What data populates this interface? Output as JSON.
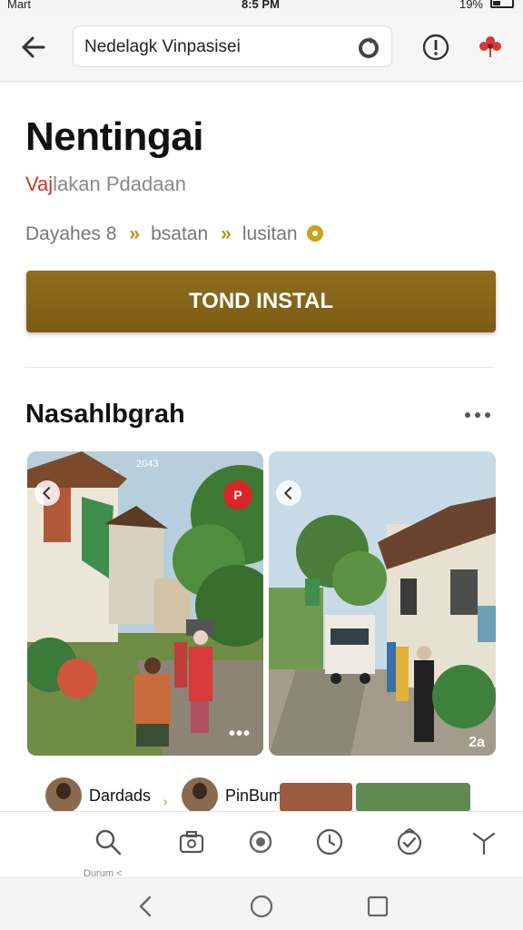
{
  "status_bar": {
    "carrier": "Mart",
    "time": "8:5 PM",
    "battery": "19%"
  },
  "app_bar": {
    "search_text": "Nedelagk Vinpasisei"
  },
  "app": {
    "title": "Nentingai",
    "subtitle_lead": "Vaj",
    "subtitle_rest": "lakan Pdadaan",
    "breadcrumbs": [
      "Dayahes 8",
      "bsatan",
      "lusitan"
    ],
    "breadcrumb_separator": "»",
    "install_label": "TOND INSTAL"
  },
  "section": {
    "title": "Nasahlbgrah"
  },
  "photos": [
    {
      "badge": "2043",
      "action_label": "P"
    },
    {
      "more_label": "2a"
    }
  ],
  "profiles": [
    {
      "name": "Dardads"
    },
    {
      "name": "PinBumnelees"
    }
  ],
  "toolbar": {
    "icons": [
      "search-icon",
      "camera-icon",
      "eye-icon",
      "clock-icon",
      "check-badge-icon",
      "antenna-icon"
    ],
    "label": "Durum <"
  },
  "colors": {
    "accent": "#7f5f16",
    "badge_red": "#d9262b",
    "breadcrumb_sep": "#b8900f"
  }
}
